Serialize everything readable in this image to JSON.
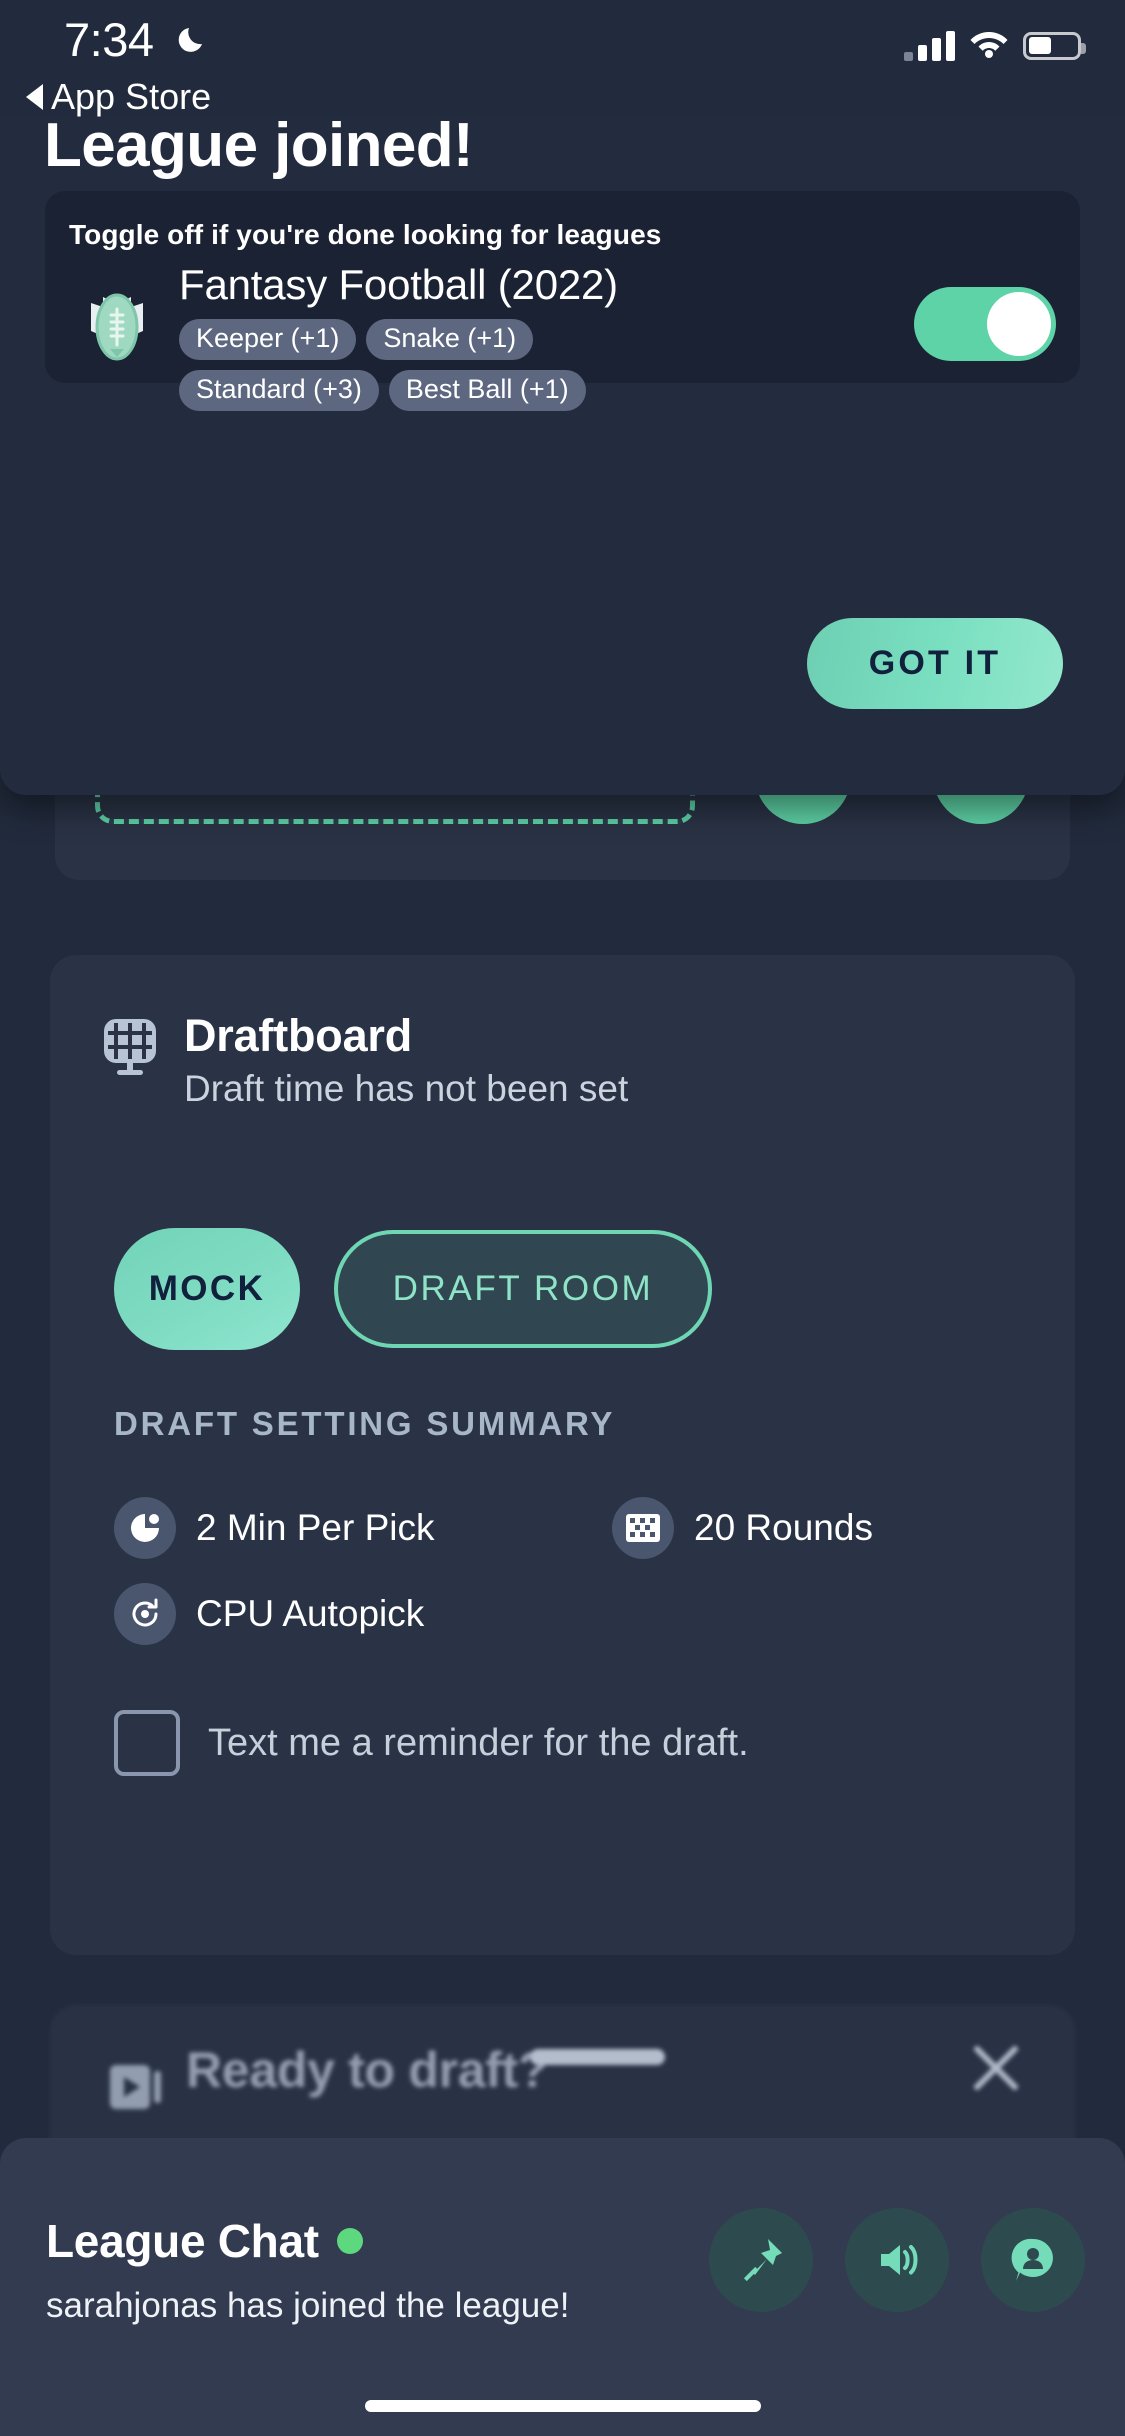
{
  "status_bar": {
    "time": "7:34",
    "moon_icon": "moon-icon",
    "signal_icon": "signal-bars-icon",
    "wifi_icon": "wifi-icon",
    "battery_icon": "battery-icon"
  },
  "back_link": {
    "label": "App Store",
    "icon": "back-caret-icon"
  },
  "page": {
    "title": "League joined!"
  },
  "modal": {
    "toggle_hint": "Toggle off if you're done looking for leagues",
    "league_name": "Fantasy Football (2022)",
    "league_badge_icon": "football-badge-icon",
    "tags": [
      "Keeper (+1)",
      "Snake (+1)",
      "Standard (+3)",
      "Best Ball (+1)"
    ],
    "toggle_state": "on",
    "toggle_color": "#5ed3a7",
    "got_it_label": "GOT IT"
  },
  "draftboard": {
    "icon": "draftboard-grid-icon",
    "title": "Draftboard",
    "subtitle": "Draft time has not been set",
    "mock_label": "MOCK",
    "draft_room_label": "DRAFT ROOM",
    "summary_label": "DRAFT SETTING SUMMARY",
    "settings": [
      {
        "icon": "clock-icon",
        "label": "2 Min Per Pick"
      },
      {
        "icon": "rounds-grid-icon",
        "label": "20 Rounds"
      },
      {
        "icon": "autopick-refresh-icon",
        "label": "CPU Autopick"
      }
    ],
    "reminder_label": "Text me a reminder for the draft.",
    "reminder_checked": false
  },
  "ready_card": {
    "icon": "video-play-icon",
    "title": "Ready to draft?",
    "close_icon": "close-icon"
  },
  "chat": {
    "title": "League Chat",
    "status_dot_color": "#5ed87f",
    "message": "sarahjonas has joined the league!",
    "actions": [
      {
        "icon": "pin-icon"
      },
      {
        "icon": "speaker-icon"
      },
      {
        "icon": "profile-chat-icon"
      }
    ]
  },
  "colors": {
    "background": "#222b3d",
    "card": "#2a3346",
    "accent_green": "#7adfc0",
    "tag_gray": "#5d6880"
  }
}
